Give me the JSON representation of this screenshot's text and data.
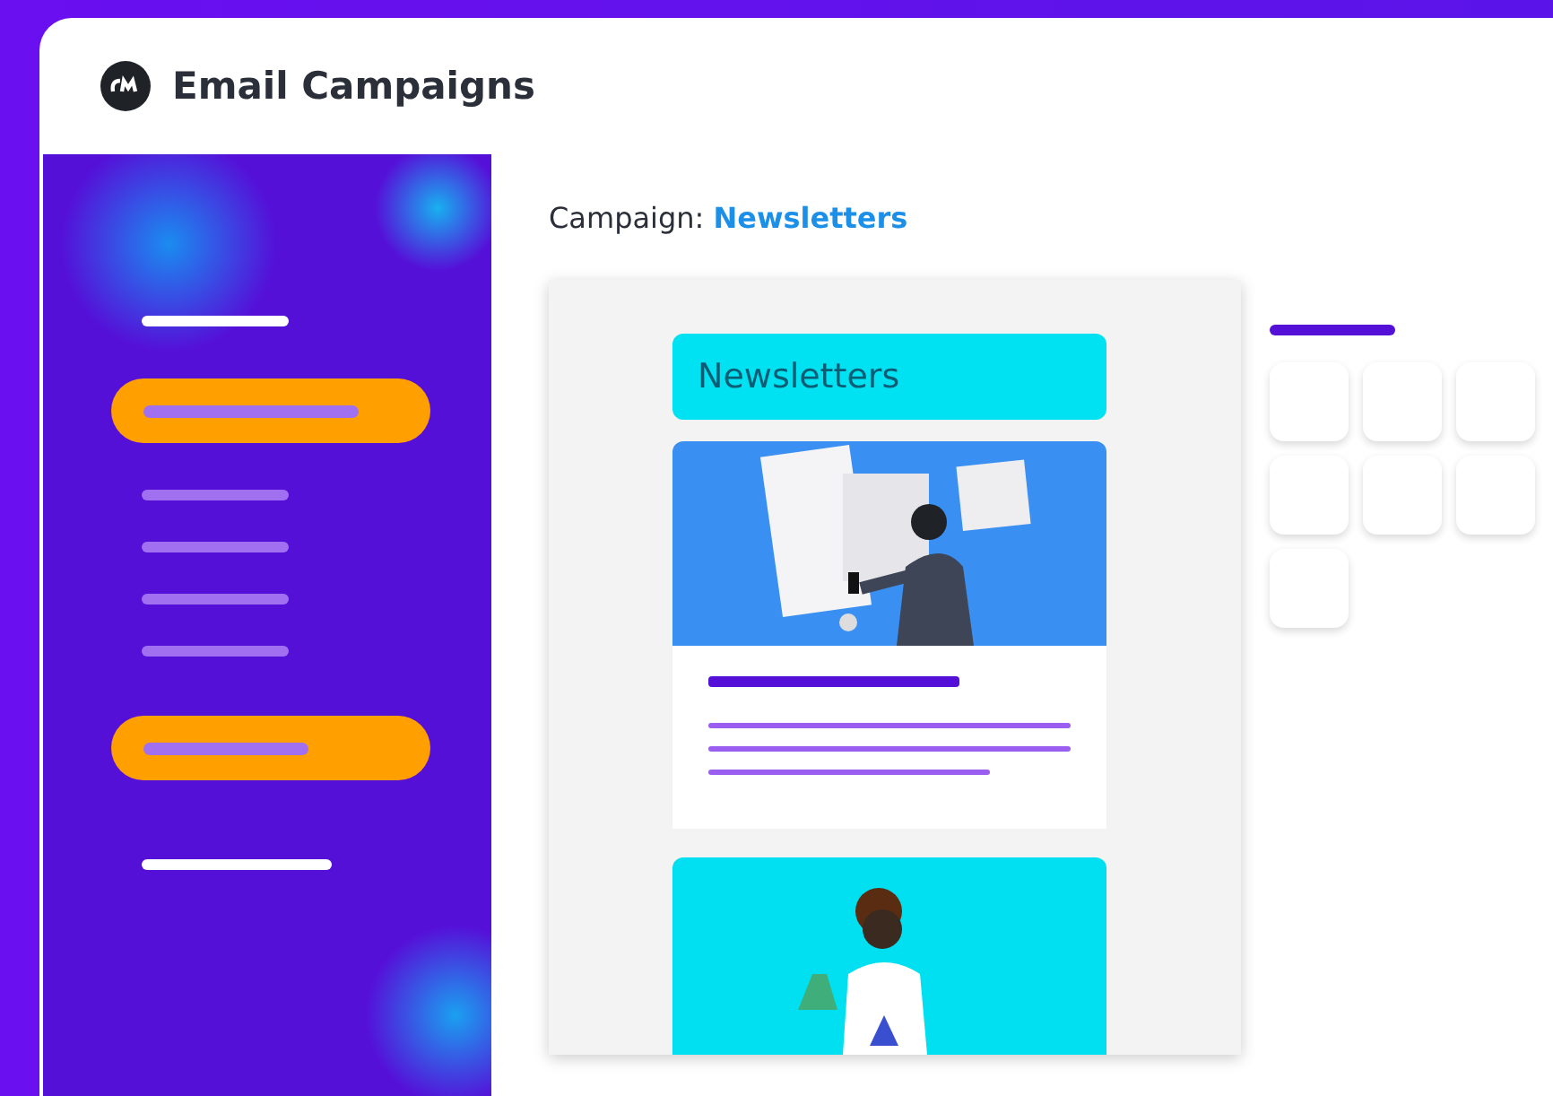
{
  "window": {
    "title": "Email Campaigns"
  },
  "sidebar": {
    "items": [
      {
        "kind": "heading",
        "selected": false
      },
      {
        "kind": "item",
        "selected": true
      },
      {
        "kind": "item",
        "selected": false
      },
      {
        "kind": "item",
        "selected": false
      },
      {
        "kind": "item",
        "selected": false
      },
      {
        "kind": "item",
        "selected": false
      },
      {
        "kind": "item",
        "selected": true
      },
      {
        "kind": "heading",
        "selected": false
      }
    ]
  },
  "campaign": {
    "label": "Campaign:",
    "name": "Newsletters"
  },
  "preview": {
    "header": "Newsletters"
  }
}
